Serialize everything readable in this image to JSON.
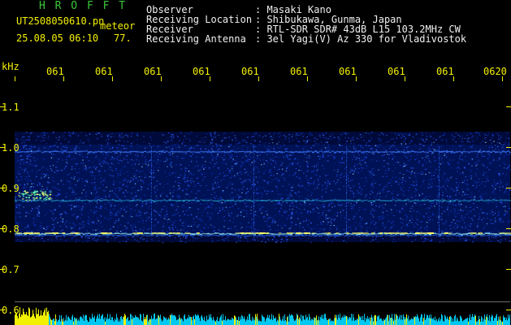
{
  "header": {
    "brand": "H R O F F T",
    "filename": "UT2508050610.pn",
    "mode": "meteor",
    "date_time": "25.08.05 06:10",
    "count": "77.",
    "info": [
      {
        "label": "Observer",
        "value": ": Masaki Kano"
      },
      {
        "label": "Receiving Location",
        "value": ": Shibukawa, Gunma, Japan"
      },
      {
        "label": "Receiver",
        "value": ": RTL-SDR SDR# 43dB L15 103.2MHz CW"
      },
      {
        "label": "Receiving Antenna",
        "value": ": 3el Yagi(V) Az 330 for Vladivostok"
      }
    ]
  },
  "axis": {
    "unit": "kHz",
    "y_ticks": [
      "1.1",
      "1.0",
      "0.9",
      "0.8",
      "0.7",
      "0.6"
    ],
    "x_ticks": [
      "061",
      "061",
      "061",
      "061",
      "061",
      "061",
      "061",
      "061",
      "061",
      "0620"
    ]
  },
  "colors": {
    "brand": "#39c93a",
    "filename": "#f4f000",
    "text": "#f0f0f0",
    "background": "#000000",
    "signal_bottom_cyan": "#00c8f0",
    "signal_bottom_yellow": "#f0f000"
  }
}
